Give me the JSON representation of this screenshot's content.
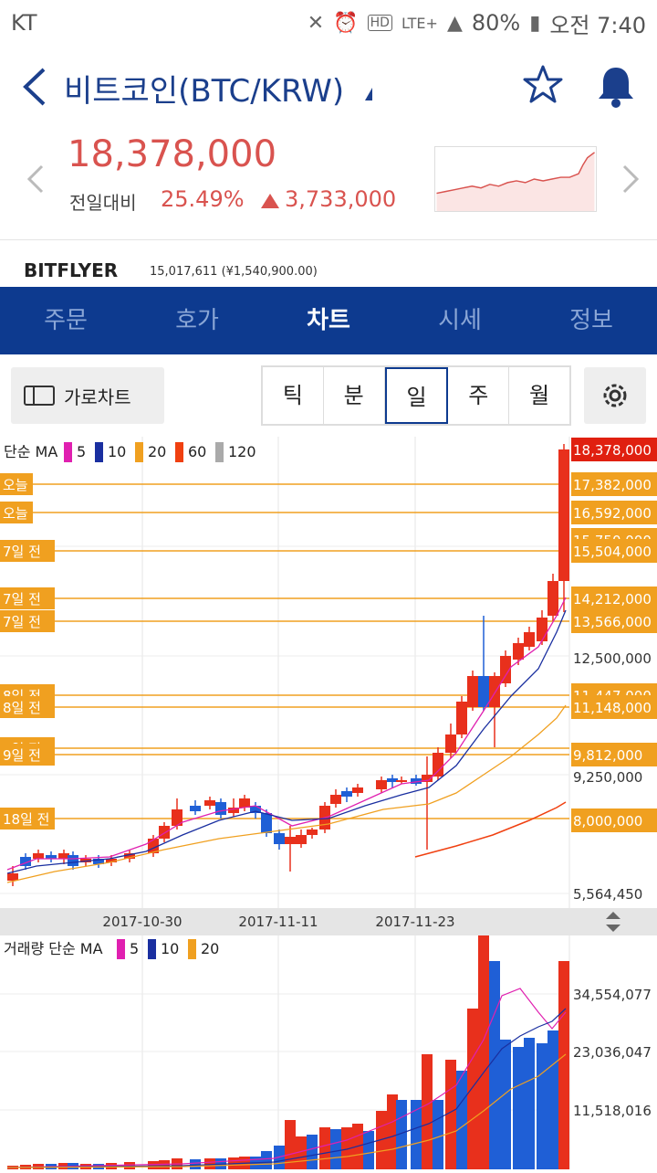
{
  "status": {
    "carrier": "KT",
    "battery": "80%",
    "time": "오전 7:40",
    "network": "LTE+",
    "hd": "HD"
  },
  "header": {
    "title": "비트코인(BTC/KRW)"
  },
  "price": {
    "current": "18,378,000",
    "compare_label": "전일대비",
    "change_pct": "25.49%",
    "change_amt": "3,733,000"
  },
  "exchange": {
    "name": "BITFLYER",
    "value": "15,017,611 (¥1,540,900.00)"
  },
  "tabs": [
    {
      "label": "주문"
    },
    {
      "label": "호가"
    },
    {
      "label": "차트"
    },
    {
      "label": "시세"
    },
    {
      "label": "정보"
    }
  ],
  "toolbar": {
    "landscape_label": "가로차트",
    "periods": [
      "틱",
      "분",
      "일",
      "주",
      "월"
    ],
    "active_period": "일"
  },
  "chart": {
    "ma_title": "단순 MA",
    "ma_legend": [
      {
        "label": "5",
        "color": "#e020b0"
      },
      {
        "label": "10",
        "color": "#1a2fa0"
      },
      {
        "label": "20",
        "color": "#f0a020"
      },
      {
        "label": "60",
        "color": "#f04010"
      },
      {
        "label": "120",
        "color": "#aaaaaa"
      }
    ],
    "right_labels": [
      "18,378,000",
      "17,382,000",
      "16,592,000",
      "15,750,000",
      "15,504,000",
      "14,212,000",
      "13,566,000",
      "12,500,000",
      "11,447,000",
      "11,148,000",
      "9,812,000",
      "9,250,000",
      "8,000,000",
      "5,564,450"
    ],
    "left_tags": [
      "오늘",
      "오늘",
      "7일 전",
      "7일 전",
      "7일 전",
      "8일 전",
      "8일 전",
      "9일 전",
      "9일 전",
      "18일 전"
    ],
    "dates": [
      "2017-10-30",
      "2017-11-11",
      "2017-11-23"
    ]
  },
  "volume": {
    "title": "거래량 단순 MA",
    "legend": [
      {
        "label": "5",
        "color": "#e020b0"
      },
      {
        "label": "10",
        "color": "#1a2fa0"
      },
      {
        "label": "20",
        "color": "#f0a020"
      }
    ],
    "right_labels": [
      "34,554,077",
      "23,036,047",
      "11,518,016"
    ]
  }
}
